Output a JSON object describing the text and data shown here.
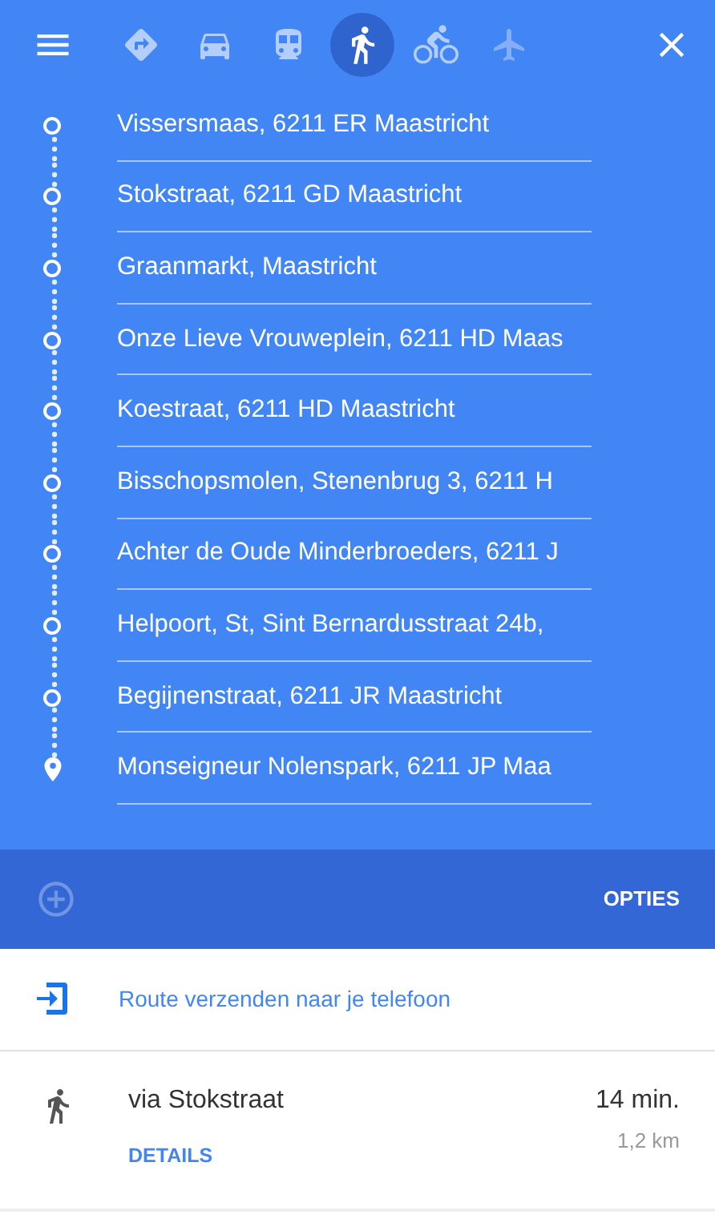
{
  "modes": [
    {
      "kind": "best",
      "selected": false,
      "disabled": false
    },
    {
      "kind": "car",
      "selected": false,
      "disabled": false
    },
    {
      "kind": "transit",
      "selected": false,
      "disabled": false
    },
    {
      "kind": "walk",
      "selected": true,
      "disabled": false
    },
    {
      "kind": "bike",
      "selected": false,
      "disabled": false
    },
    {
      "kind": "flight",
      "selected": false,
      "disabled": true
    }
  ],
  "stops": [
    {
      "text": "Vissersmaas, 6211 ER Maastricht",
      "kind": "waypoint"
    },
    {
      "text": "Stokstraat, 6211 GD Maastricht",
      "kind": "waypoint"
    },
    {
      "text": "Graanmarkt, Maastricht",
      "kind": "waypoint"
    },
    {
      "text": "Onze Lieve Vrouweplein, 6211 HD Maas",
      "kind": "waypoint"
    },
    {
      "text": "Koestraat, 6211 HD Maastricht",
      "kind": "waypoint"
    },
    {
      "text": "Bisschopsmolen, Stenenbrug 3, 6211 H",
      "kind": "waypoint"
    },
    {
      "text": "Achter de Oude Minderbroeders, 6211 J",
      "kind": "waypoint"
    },
    {
      "text": "Helpoort, St, Sint Bernardusstraat 24b,",
      "kind": "waypoint"
    },
    {
      "text": "Begijnenstraat, 6211 JR Maastricht",
      "kind": "waypoint"
    },
    {
      "text": "Monseigneur Nolenspark, 6211 JP Maa",
      "kind": "destination"
    }
  ],
  "add_stop": {
    "disabled": true
  },
  "options_label": "OPTIES",
  "send_to_phone": "Route verzenden naar je telefoon",
  "route": {
    "via": "via Stokstraat",
    "details": "DETAILS",
    "duration": "14 min.",
    "distance": "1,2 km"
  }
}
